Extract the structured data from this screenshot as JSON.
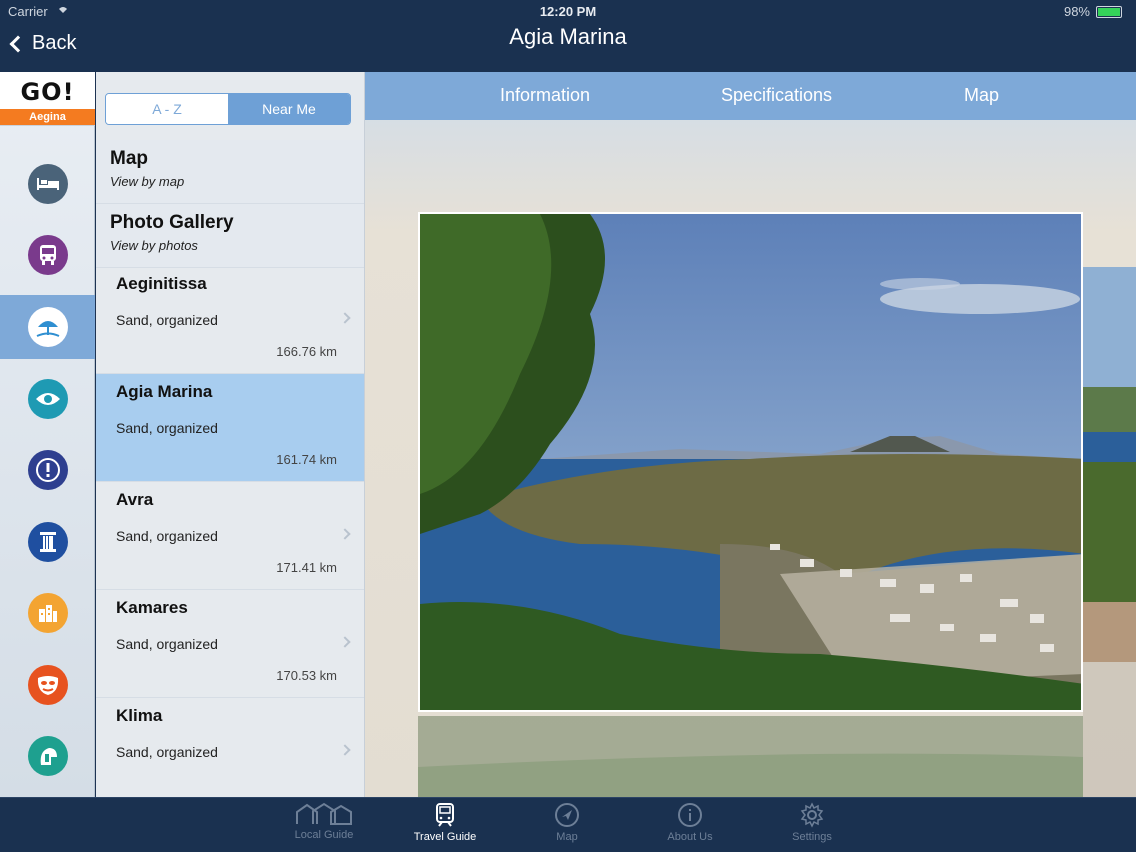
{
  "status": {
    "carrier": "Carrier",
    "time": "12:20 PM",
    "battery": "98%"
  },
  "nav": {
    "back_label": "Back",
    "title": "Agia Marina"
  },
  "logo": {
    "mark": "GO!",
    "region": "Aegina"
  },
  "rail": [
    {
      "name": "bed-icon",
      "color": "#4a6379"
    },
    {
      "name": "bus-icon",
      "color": "#7a3a8c"
    },
    {
      "name": "beach-umbrella-icon",
      "color": "#ffffff"
    },
    {
      "name": "eye-icon",
      "color": "#1e9ab3"
    },
    {
      "name": "alert-icon",
      "color": "#2e3f8f"
    },
    {
      "name": "column-icon",
      "color": "#1f4fa0"
    },
    {
      "name": "city-icon",
      "color": "#f3a432"
    },
    {
      "name": "mask-icon",
      "color": "#e7521f"
    },
    {
      "name": "helmet-icon",
      "color": "#1ea08f"
    }
  ],
  "segment": {
    "az": "A - Z",
    "near": "Near Me"
  },
  "list_headers": [
    {
      "title": "Map",
      "subtitle": "View by map"
    },
    {
      "title": "Photo Gallery",
      "subtitle": "View by photos"
    }
  ],
  "items": [
    {
      "name": "Aeginitissa",
      "desc": "Sand, organized",
      "dist": "166.76 km"
    },
    {
      "name": "Agia Marina",
      "desc": "Sand, organized",
      "dist": "161.74 km"
    },
    {
      "name": "Avra",
      "desc": "Sand, organized",
      "dist": "171.41 km"
    },
    {
      "name": "Kamares",
      "desc": "Sand, organized",
      "dist": "170.53 km"
    },
    {
      "name": "Klima",
      "desc": "Sand, organized",
      "dist": ""
    }
  ],
  "tabs": {
    "info": "Information",
    "specs": "Specifications",
    "map": "Map"
  },
  "tabbar": {
    "local": "Local Guide",
    "travel": "Travel Guide",
    "map": "Map",
    "about": "About Us",
    "settings": "Settings"
  }
}
